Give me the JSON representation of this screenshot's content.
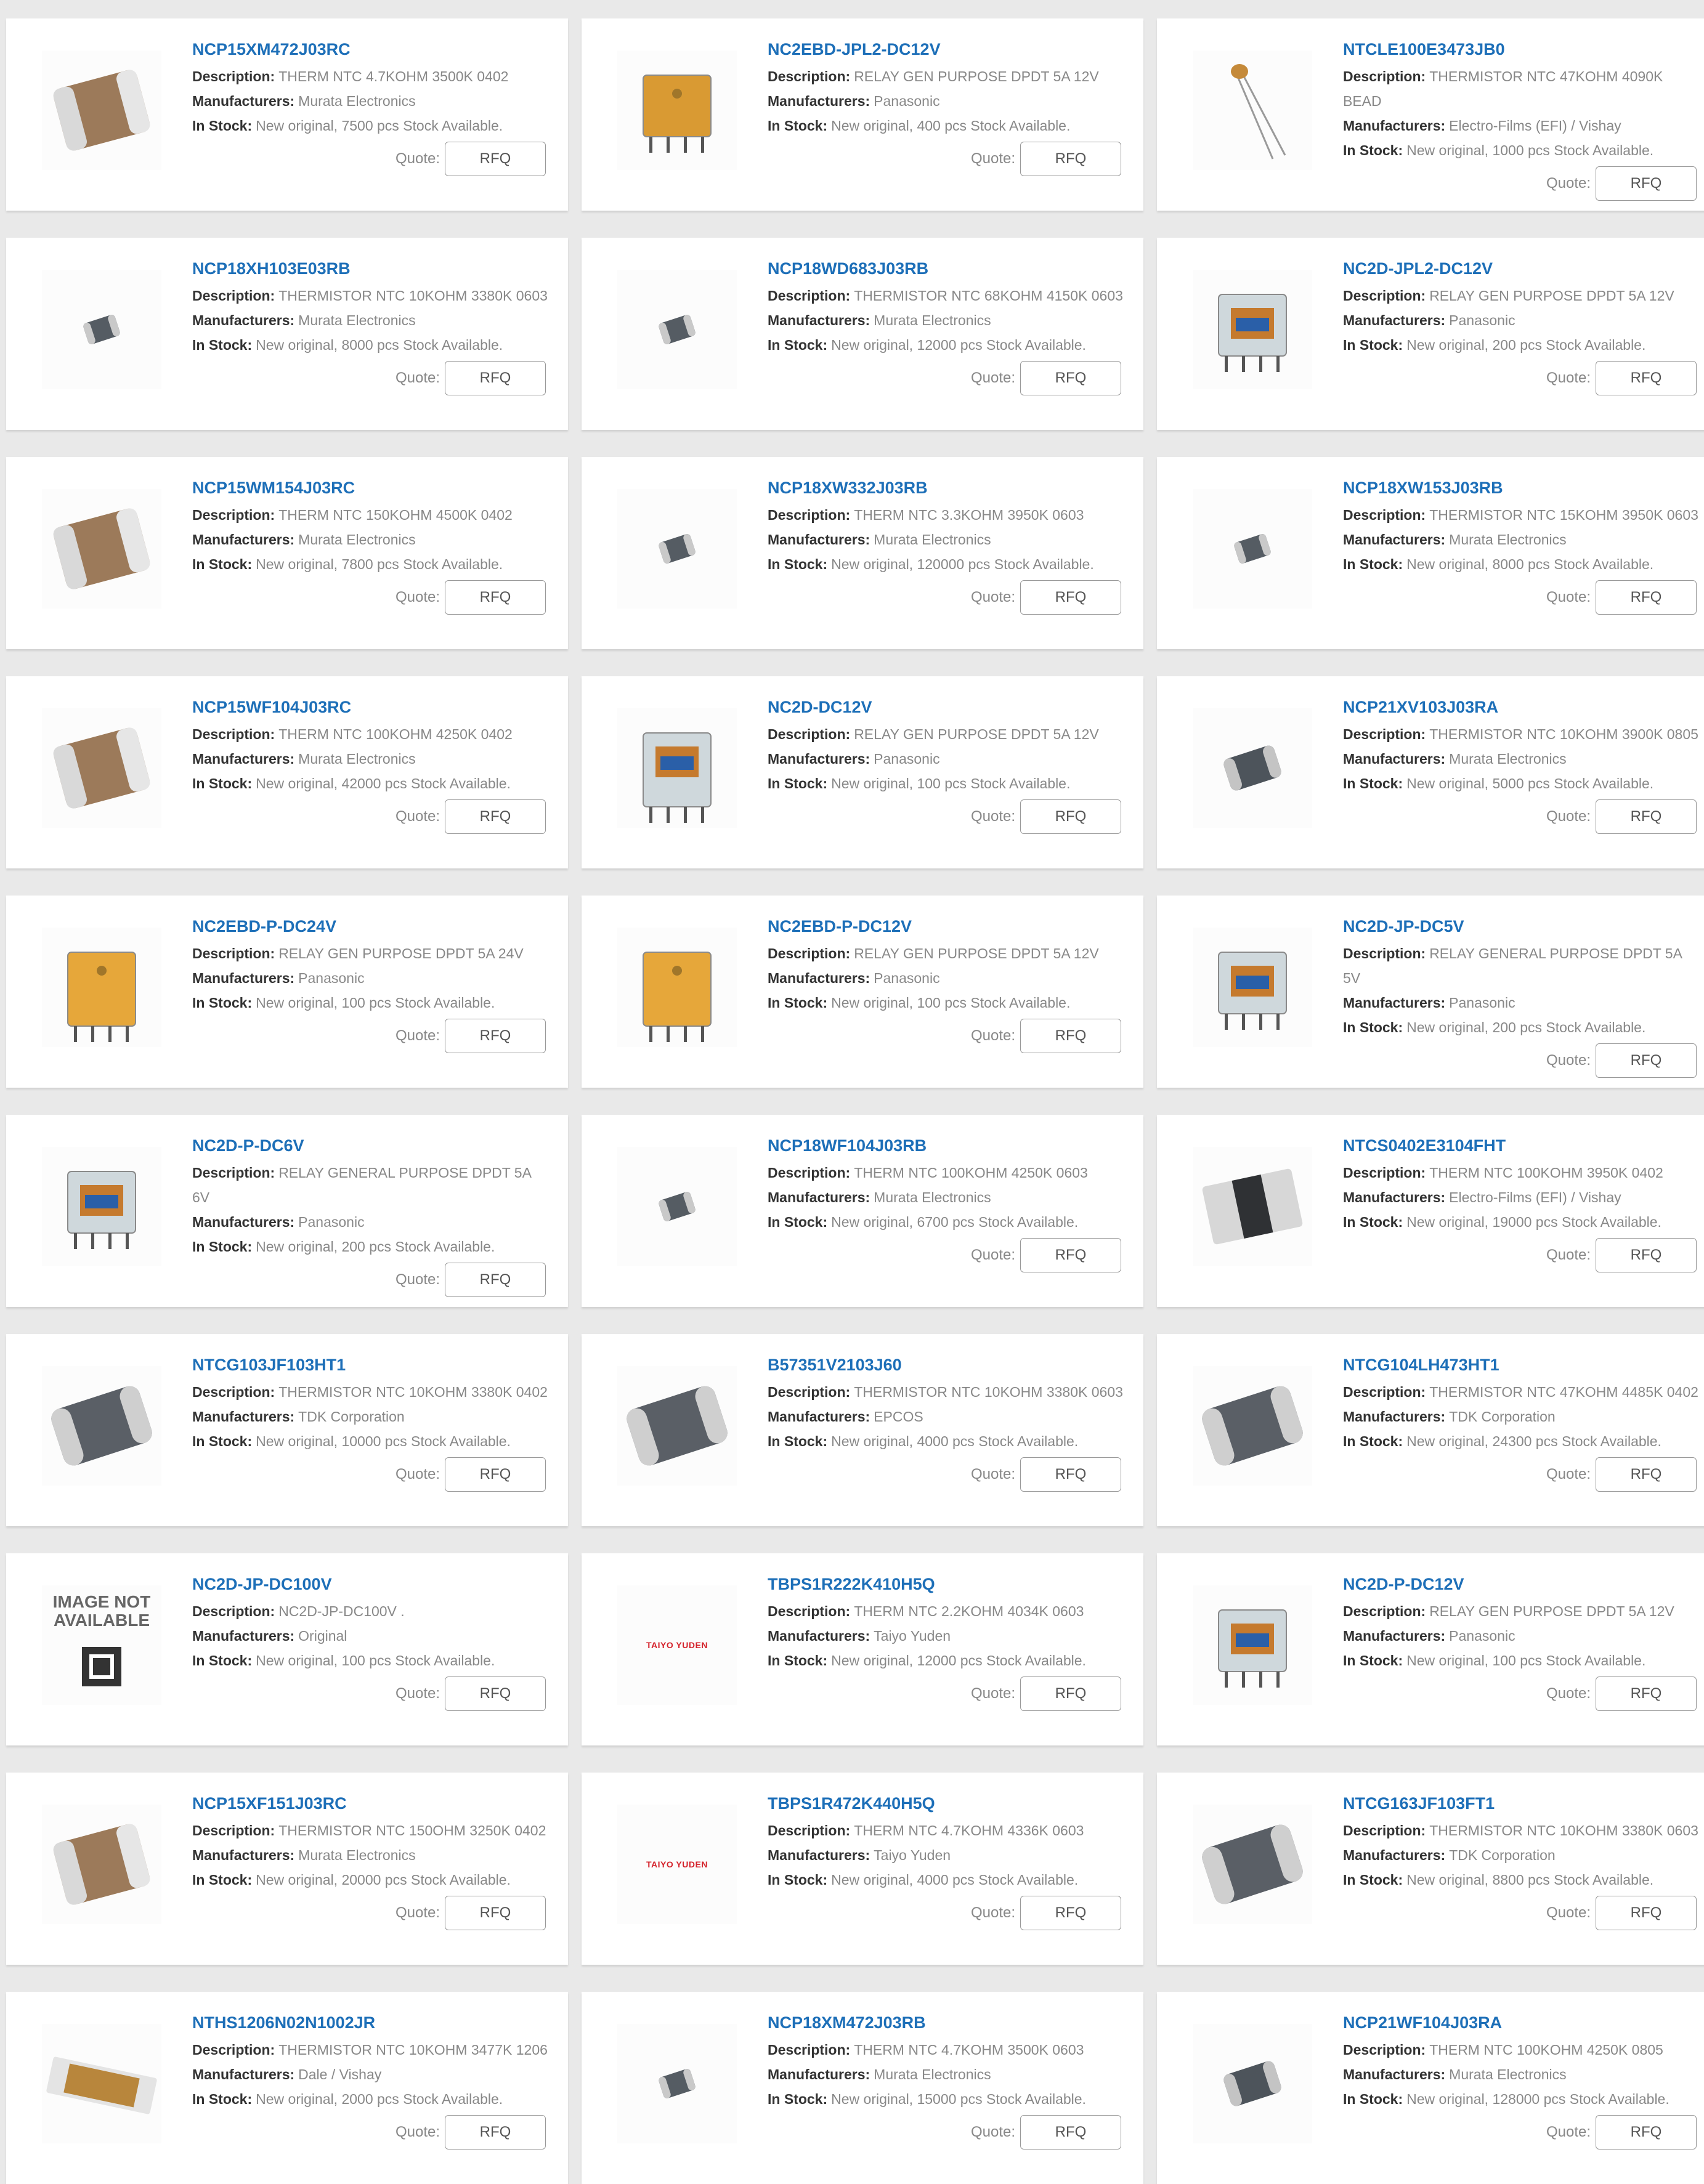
{
  "labels": {
    "description": "Description:",
    "manufacturers": "Manufacturers:",
    "in_stock": "In Stock:",
    "quote": "Quote:",
    "rfq": "RFQ"
  },
  "products": [
    {
      "part": "NCP15XM472J03RC",
      "description": "THERM NTC 4.7KOHM 3500K 0402",
      "manufacturer": "Murata Electronics",
      "stock": "New original, 7500 pcs Stock Available.",
      "image": "mlcc-chip"
    },
    {
      "part": "NC2EBD-JPL2-DC12V",
      "description": "RELAY GEN PURPOSE DPDT 5A 12V",
      "manufacturer": "Panasonic",
      "stock": "New original, 400 pcs Stock Available.",
      "image": "relay-flat-yellow"
    },
    {
      "part": "NTCLE100E3473JB0",
      "description": "THERMISTOR NTC 47KOHM 4090K BEAD",
      "manufacturer": "Electro-Films (EFI) / Vishay",
      "stock": "New original, 1000 pcs Stock Available.",
      "image": "bead-thermistor"
    },
    {
      "part": "NCP18XH103E03RB",
      "description": "THERMISTOR NTC 10KOHM 3380K 0603",
      "manufacturer": "Murata Electronics",
      "stock": "New original, 8000 pcs Stock Available.",
      "image": "small-chip"
    },
    {
      "part": "NCP18WD683J03RB",
      "description": "THERMISTOR NTC 68KOHM 4150K 0603",
      "manufacturer": "Murata Electronics",
      "stock": "New original, 12000 pcs Stock Available.",
      "image": "small-chip"
    },
    {
      "part": "NC2D-JPL2-DC12V",
      "description": "RELAY GEN PURPOSE DPDT 5A 12V",
      "manufacturer": "Panasonic",
      "stock": "New original, 200 pcs Stock Available.",
      "image": "relay-clear"
    },
    {
      "part": "NCP15WM154J03RC",
      "description": "THERM NTC 150KOHM 4500K 0402",
      "manufacturer": "Murata Electronics",
      "stock": "New original, 7800 pcs Stock Available.",
      "image": "mlcc-chip"
    },
    {
      "part": "NCP18XW332J03RB",
      "description": "THERM NTC 3.3KOHM 3950K 0603",
      "manufacturer": "Murata Electronics",
      "stock": "New original, 120000 pcs Stock Available.",
      "image": "small-chip"
    },
    {
      "part": "NCP18XW153J03RB",
      "description": "THERMISTOR NTC 15KOHM 3950K 0603",
      "manufacturer": "Murata Electronics",
      "stock": "New original, 8000 pcs Stock Available.",
      "image": "small-chip"
    },
    {
      "part": "NCP15WF104J03RC",
      "description": "THERM NTC 100KOHM 4250K 0402",
      "manufacturer": "Murata Electronics",
      "stock": "New original, 42000 pcs Stock Available.",
      "image": "mlcc-chip"
    },
    {
      "part": "NC2D-DC12V",
      "description": "RELAY GEN PURPOSE DPDT 5A 12V",
      "manufacturer": "Panasonic",
      "stock": "New original, 100 pcs Stock Available.",
      "image": "relay-clear-tall"
    },
    {
      "part": "NCP21XV103J03RA",
      "description": "THERMISTOR NTC 10KOHM 3900K 0805",
      "manufacturer": "Murata Electronics",
      "stock": "New original, 5000 pcs Stock Available.",
      "image": "medium-chip"
    },
    {
      "part": "NC2EBD-P-DC24V",
      "description": "RELAY GEN PURPOSE DPDT 5A 24V",
      "manufacturer": "Panasonic",
      "stock": "New original, 100 pcs Stock Available.",
      "image": "relay-yellow"
    },
    {
      "part": "NC2EBD-P-DC12V",
      "description": "RELAY GEN PURPOSE DPDT 5A 12V",
      "manufacturer": "Panasonic",
      "stock": "New original, 100 pcs Stock Available.",
      "image": "relay-yellow"
    },
    {
      "part": "NC2D-JP-DC5V",
      "description": "RELAY GENERAL PURPOSE DPDT 5A 5V",
      "manufacturer": "Panasonic",
      "stock": "New original, 200 pcs Stock Available.",
      "image": "relay-flat-clear"
    },
    {
      "part": "NC2D-P-DC6V",
      "description": "RELAY GENERAL PURPOSE DPDT 5A 6V",
      "manufacturer": "Panasonic",
      "stock": "New original, 200 pcs Stock Available.",
      "image": "relay-clear"
    },
    {
      "part": "NCP18WF104J03RB",
      "description": "THERM NTC 100KOHM 4250K 0603",
      "manufacturer": "Murata Electronics",
      "stock": "New original, 6700 pcs Stock Available.",
      "image": "small-chip"
    },
    {
      "part": "NTCS0402E3104FHT",
      "description": "THERM NTC 100KOHM 3950K 0402",
      "manufacturer": "Electro-Films (EFI) / Vishay",
      "stock": "New original, 19000 pcs Stock Available.",
      "image": "black-chip"
    },
    {
      "part": "NTCG103JF103HT1",
      "description": "THERMISTOR NTC 10KOHM 3380K 0402",
      "manufacturer": "TDK Corporation",
      "stock": "New original, 10000 pcs Stock Available.",
      "image": "large-chip"
    },
    {
      "part": "B57351V2103J60",
      "description": "THERMISTOR NTC 10KOHM 3380K 0603",
      "manufacturer": "EPCOS",
      "stock": "New original, 4000 pcs Stock Available.",
      "image": "large-chip"
    },
    {
      "part": "NTCG104LH473HT1",
      "description": "THERMISTOR NTC 47KOHM 4485K 0402",
      "manufacturer": "TDK Corporation",
      "stock": "New original, 24300 pcs Stock Available.",
      "image": "large-chip"
    },
    {
      "part": "NC2D-JP-DC100V",
      "description": "NC2D-JP-DC100V   .",
      "manufacturer": "Original",
      "stock": "New original, 100 pcs Stock Available.",
      "image": "not-available",
      "image_text": "IMAGE NOT AVAILABLE"
    },
    {
      "part": "TBPS1R222K410H5Q",
      "description": "THERM NTC 2.2KOHM 4034K 0603",
      "manufacturer": "Taiyo Yuden",
      "stock": "New original, 12000 pcs Stock Available.",
      "image": "brand-logo",
      "image_text": "TAIYO YUDEN"
    },
    {
      "part": "NC2D-P-DC12V",
      "description": "RELAY GEN PURPOSE DPDT 5A 12V",
      "manufacturer": "Panasonic",
      "stock": "New original, 100 pcs Stock Available.",
      "image": "relay-clear"
    },
    {
      "part": "NCP15XF151J03RC",
      "description": "THERMISTOR NTC 150OHM 3250K 0402",
      "manufacturer": "Murata Electronics",
      "stock": "New original, 20000 pcs Stock Available.",
      "image": "mlcc-chip"
    },
    {
      "part": "TBPS1R472K440H5Q",
      "description": "THERM NTC 4.7KOHM 4336K 0603",
      "manufacturer": "Taiyo Yuden",
      "stock": "New original, 4000 pcs Stock Available.",
      "image": "brand-logo",
      "image_text": "TAIYO YUDEN"
    },
    {
      "part": "NTCG163JF103FT1",
      "description": "THERMISTOR NTC 10KOHM 3380K 0603",
      "manufacturer": "TDK Corporation",
      "stock": "New original, 8800 pcs Stock Available.",
      "image": "large-chip"
    },
    {
      "part": "NTHS1206N02N1002JR",
      "description": "THERMISTOR NTC 10KOHM 3477K 1206",
      "manufacturer": "Dale / Vishay",
      "stock": "New original, 2000 pcs Stock Available.",
      "image": "flat-chip"
    },
    {
      "part": "NCP18XM472J03RB",
      "description": "THERM NTC 4.7KOHM 3500K 0603",
      "manufacturer": "Murata Electronics",
      "stock": "New original, 15000 pcs Stock Available.",
      "image": "small-chip"
    },
    {
      "part": "NCP21WF104J03RA",
      "description": "THERM NTC 100KOHM 4250K 0805",
      "manufacturer": "Murata Electronics",
      "stock": "New original, 128000 pcs Stock Available.",
      "image": "medium-chip"
    }
  ],
  "colors": {
    "link": "#1d6fb8",
    "page_bg": "#e9e9e9",
    "card_bg": "#ffffff"
  }
}
